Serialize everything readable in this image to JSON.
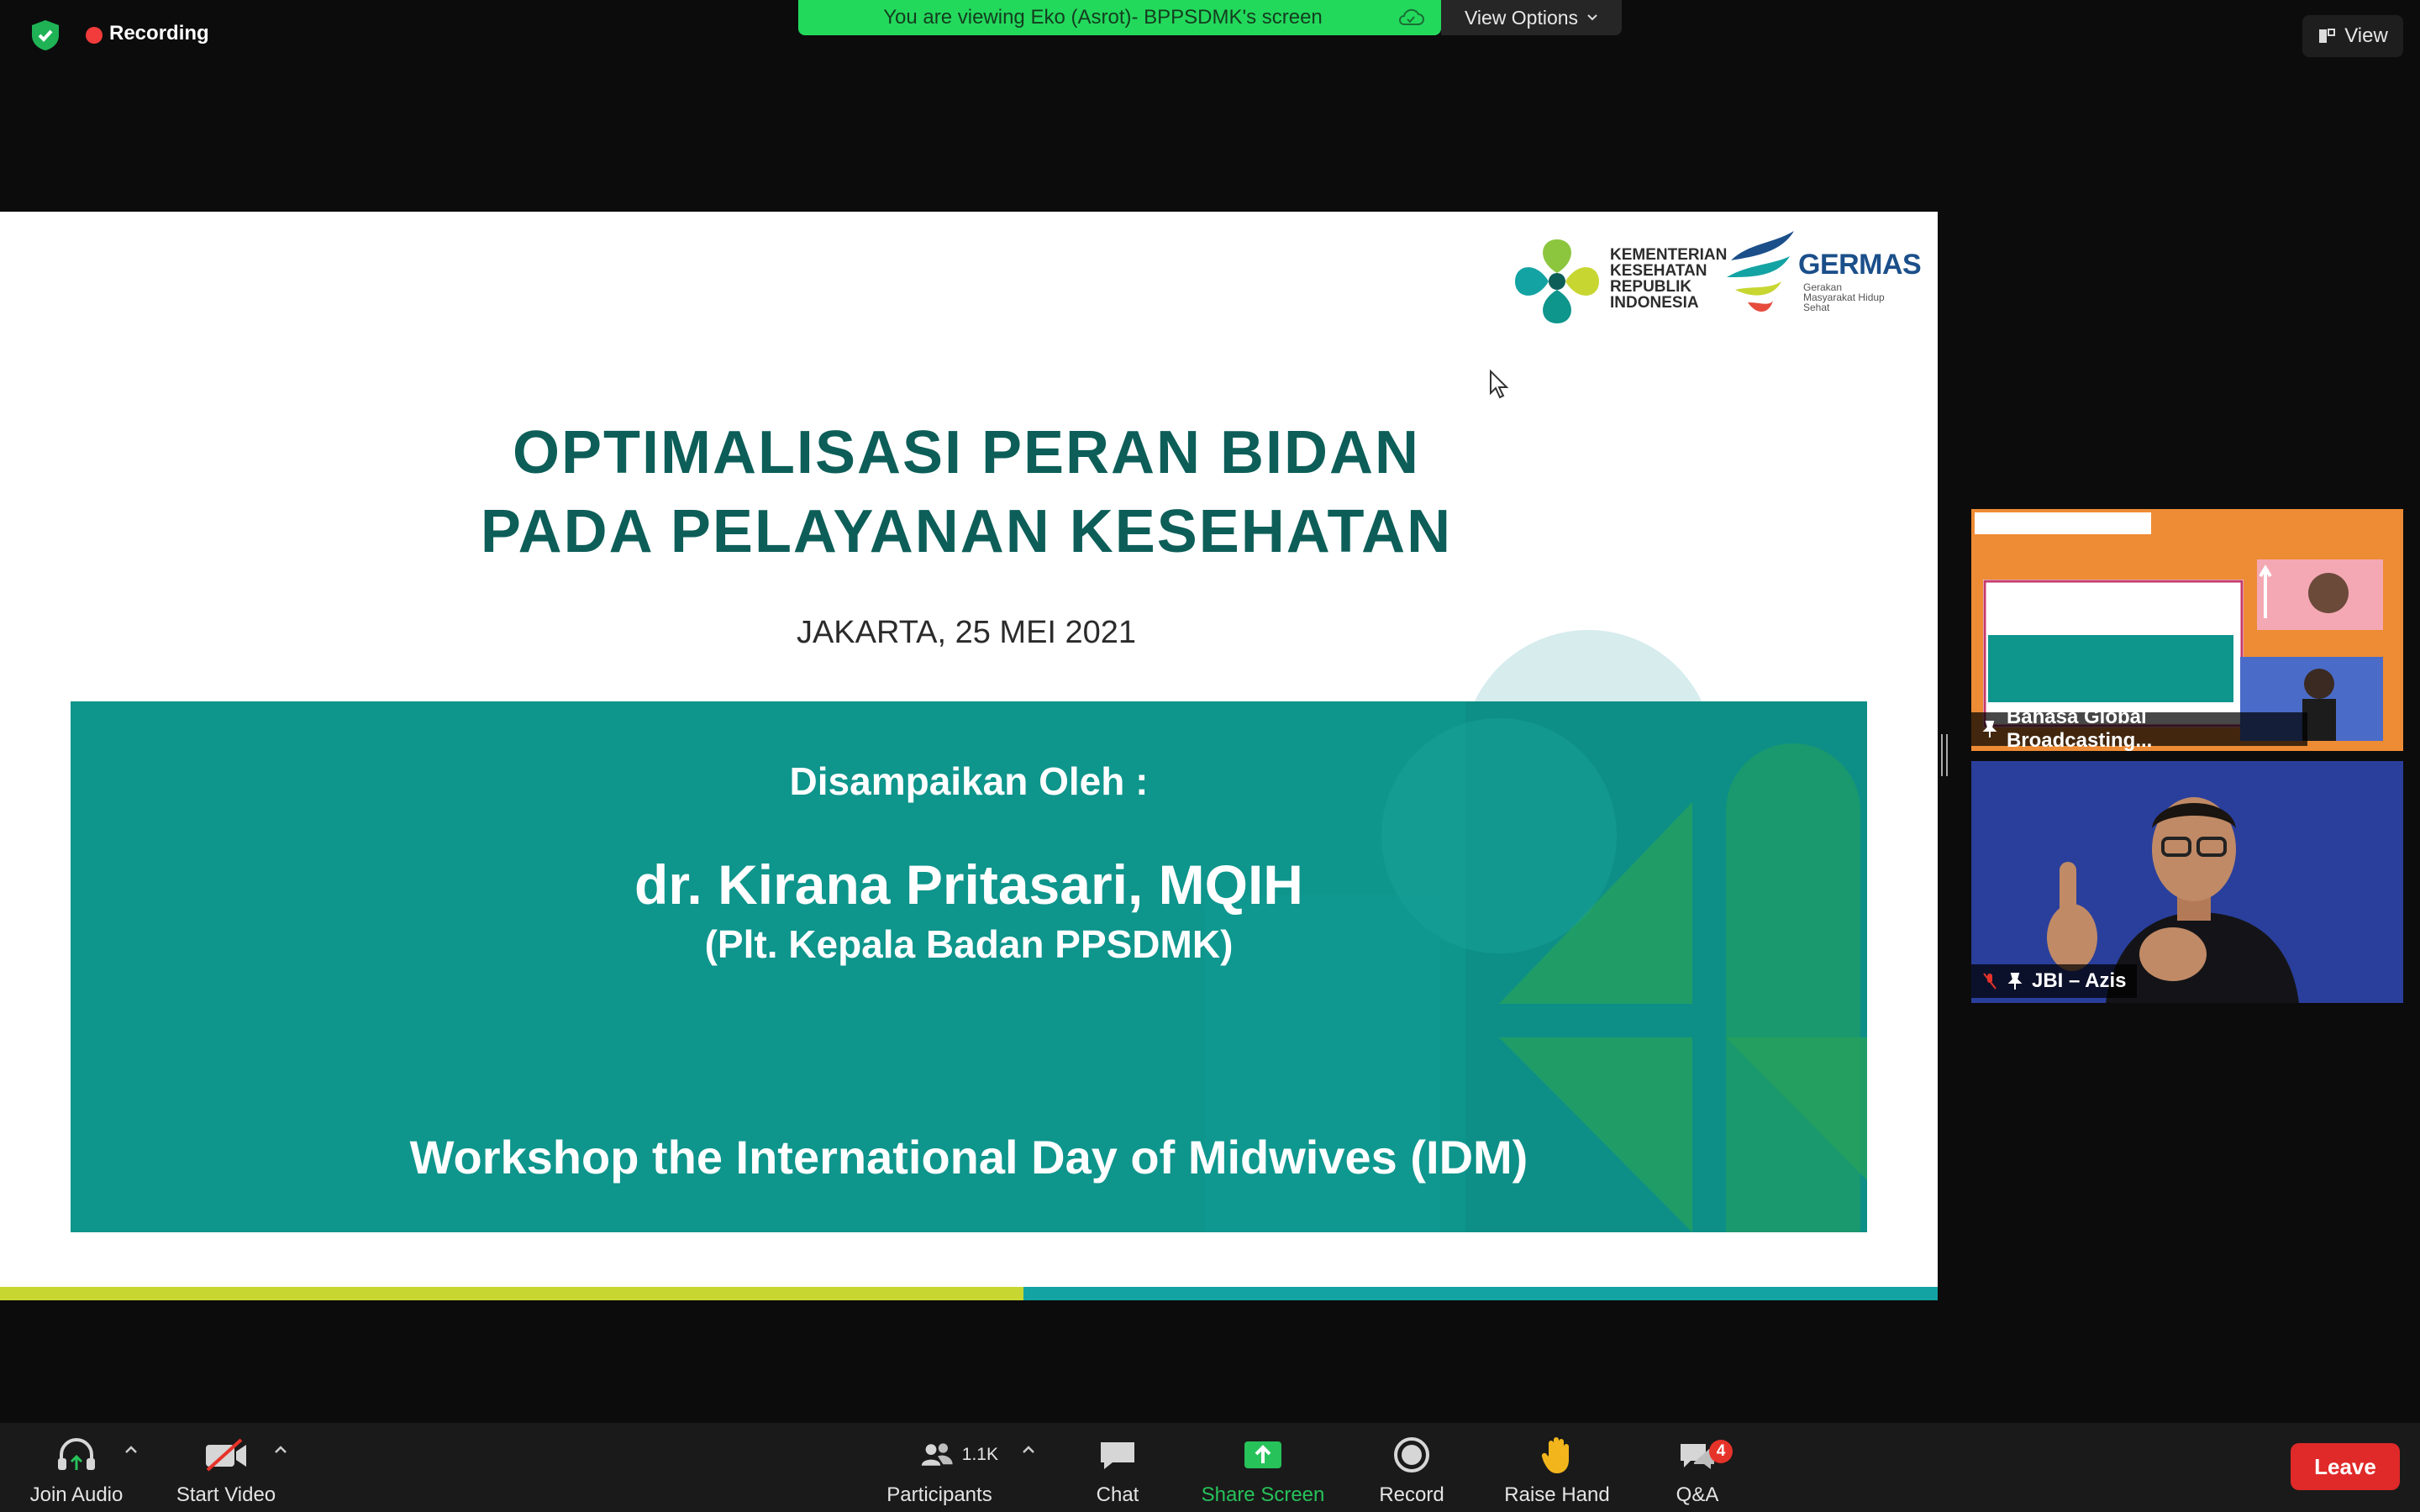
{
  "top_bar": {
    "recording_label": "Recording",
    "viewing_banner": "You are viewing Eko (Asrot)- BPPSDMK's screen",
    "view_options_label": "View Options",
    "view_label": "View"
  },
  "slide": {
    "ministry_logo_text": "KEMENTERIAN KESEHATAN REPUBLIK INDONESIA",
    "germas_logo_text": "GERMAS",
    "germas_subtitle": "Gerakan Masyarakat Hidup Sehat",
    "title_line1": "OPTIMALISASI PERAN BIDAN",
    "title_line2": "PADA PELAYANAN KESEHATAN",
    "date": "JAKARTA, 25 MEI 2021",
    "presented_by": "Disampaikan Oleh :",
    "speaker_name": "dr. Kirana Pritasari, MQIH",
    "speaker_role": "(Plt. Kepala Badan PPSDMK)",
    "event": "Workshop the International Day of Midwives (IDM)"
  },
  "participants_videos": [
    {
      "name": "Bahasa Global Broadcasting..."
    },
    {
      "name": "JBI – Azis"
    }
  ],
  "toolbar": {
    "join_audio": "Join Audio",
    "start_video": "Start Video",
    "participants": "Participants",
    "participants_count": "1.1K",
    "chat": "Chat",
    "share_screen": "Share Screen",
    "record": "Record",
    "raise_hand": "Raise Hand",
    "qa": "Q&A",
    "qa_badge": "4",
    "leave": "Leave"
  },
  "colors": {
    "banner_green": "#23d95c",
    "slide_teal": "#0e958c",
    "title_teal": "#0d5e58",
    "leave_red": "#e02929"
  }
}
